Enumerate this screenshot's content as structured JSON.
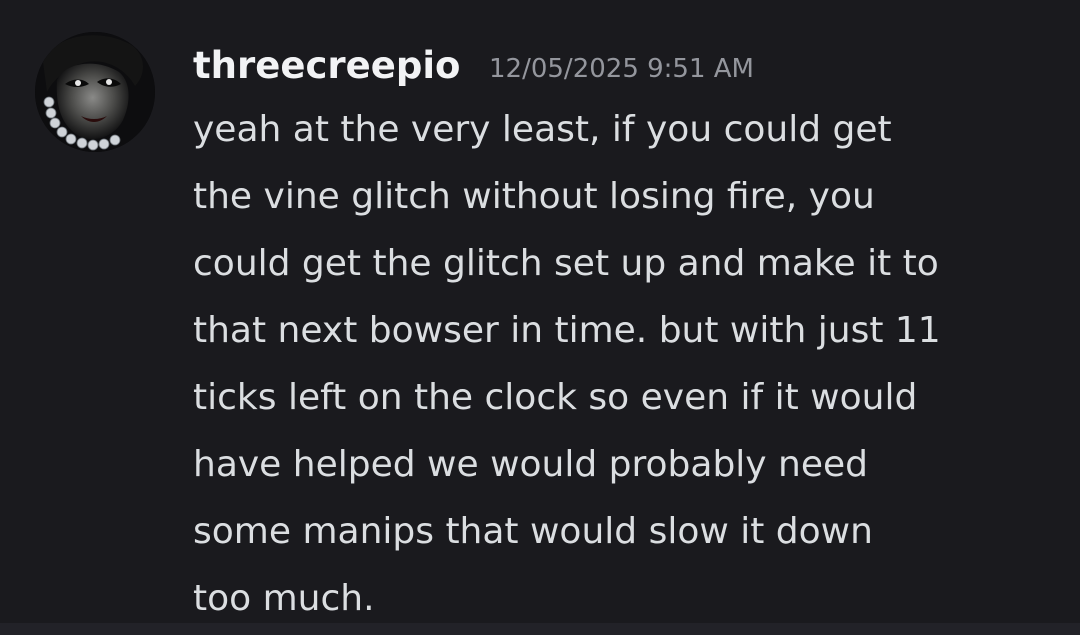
{
  "message": {
    "author": "threecreepio",
    "timestamp": "12/05/2025 9:51 AM",
    "avatar_icon": "user-avatar-icon",
    "lines": [
      "yeah at the very least, if you could get",
      "the vine glitch without losing fire, you",
      "could get the glitch set up and make it to",
      "that next bowser in time. but with just 11",
      "ticks left on the clock so even if it would",
      "have helped we would probably need",
      "some manips that would slow it down",
      "too much."
    ]
  },
  "colors": {
    "background": "#1a1a1e",
    "username": "#f2f3f5",
    "timestamp": "#94969d",
    "text": "#dbdee1"
  }
}
